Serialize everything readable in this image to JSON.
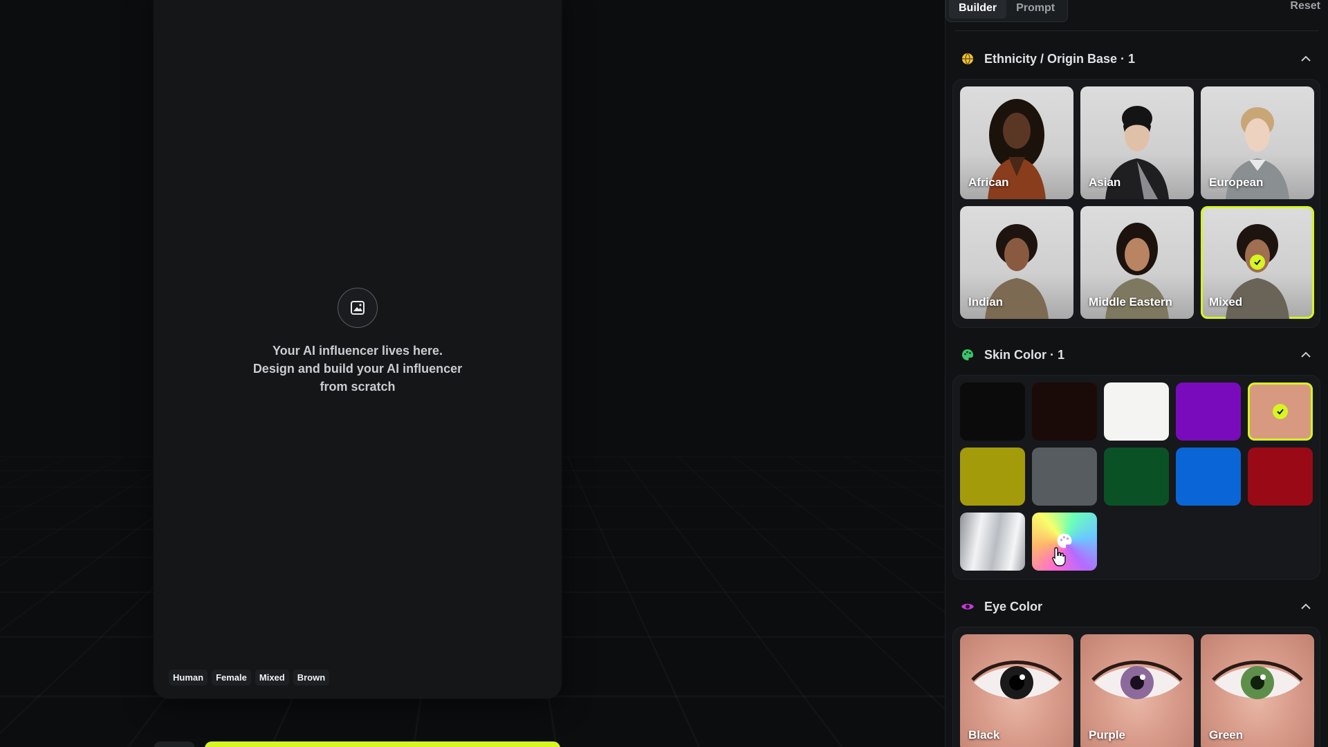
{
  "preview": {
    "empty_lines": [
      "Your AI influencer lives here.",
      "Design and build your AI influencer",
      "from scratch"
    ],
    "tags": [
      "Human",
      "Female",
      "Mixed",
      "Brown"
    ]
  },
  "panel": {
    "tabs": [
      {
        "label": "Builder",
        "active": true
      },
      {
        "label": "Prompt",
        "active": false
      }
    ],
    "reset_label": "Reset",
    "ethnicity": {
      "title": "Ethnicity / Origin Base · 1",
      "icon": "globe-icon",
      "options": [
        {
          "label": "African",
          "selected": false
        },
        {
          "label": "Asian",
          "selected": false
        },
        {
          "label": "European",
          "selected": false
        },
        {
          "label": "Indian",
          "selected": false
        },
        {
          "label": "Middle Eastern",
          "selected": false
        },
        {
          "label": "Mixed",
          "selected": true
        }
      ]
    },
    "skin": {
      "title": "Skin Color · 1",
      "icon": "palette-icon",
      "swatches": [
        {
          "color": "#0b0b0b",
          "selected": false
        },
        {
          "color": "#1a0b08",
          "selected": false
        },
        {
          "color": "#f4f4f2",
          "selected": false
        },
        {
          "color": "#7a0bbd",
          "selected": false
        },
        {
          "color": "#d79a80",
          "selected": true
        },
        {
          "color": "#a39b0a",
          "selected": false
        },
        {
          "color": "#565c60",
          "selected": false
        },
        {
          "color": "#0a5226",
          "selected": false
        },
        {
          "color": "#0a66d6",
          "selected": false
        },
        {
          "color": "#9a0a16",
          "selected": false
        },
        {
          "color": "silver",
          "selected": false
        },
        {
          "color": "custom",
          "selected": false
        }
      ]
    },
    "eye": {
      "title": "Eye Color",
      "icon": "eye-icon",
      "options": [
        {
          "label": "Black",
          "iris": "#1a1a1a"
        },
        {
          "label": "Purple",
          "iris": "#8c6a9c"
        },
        {
          "label": "Green",
          "iris": "#5e8f4a"
        }
      ]
    }
  },
  "colors": {
    "accent": "#d7f520",
    "panel_bg": "#101214",
    "stage_bg": "#0b0d0f"
  }
}
